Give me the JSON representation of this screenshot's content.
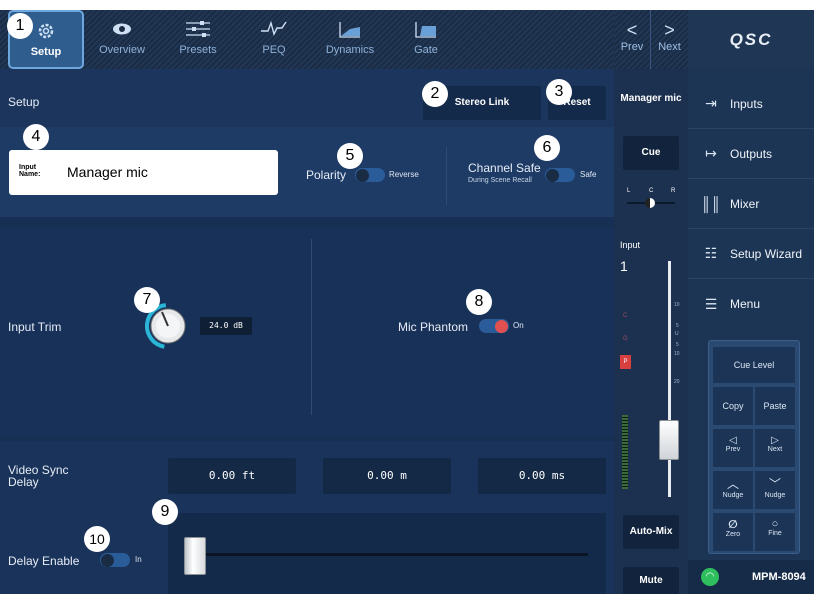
{
  "tabs": [
    {
      "label": "Setup",
      "icon": "gear-icon"
    },
    {
      "label": "Overview",
      "icon": "eye-icon"
    },
    {
      "label": "Presets",
      "icon": "sliders-icon"
    },
    {
      "label": "PEQ",
      "icon": "peq-curve-icon"
    },
    {
      "label": "Dynamics",
      "icon": "dynamics-icon"
    },
    {
      "label": "Gate",
      "icon": "gate-icon"
    }
  ],
  "nav": {
    "prev": "Prev",
    "next": "Next"
  },
  "brand": "QSC",
  "setup": {
    "title": "Setup",
    "stereo_link": "Stereo Link",
    "reset": "Reset",
    "input_name_label": "Input Name:",
    "input_name_value": "Manager mic",
    "polarity_label": "Polarity",
    "polarity_state": "Reverse",
    "channel_safe_label": "Channel Safe",
    "channel_safe_sub": "During Scene Recall",
    "channel_safe_state": "Safe",
    "input_trim_label": "Input Trim",
    "input_trim_value": "24.0 dB",
    "mic_phantom_label": "Mic Phantom",
    "mic_phantom_state": "On",
    "video_sync_label": "Video Sync Delay",
    "delay_ft": "0.00 ft",
    "delay_m": "0.00 m",
    "delay_ms": "0.00 ms",
    "delay_enable_label": "Delay Enable",
    "delay_enable_state": "In"
  },
  "strip": {
    "channel_name": "Manager mic",
    "cue": "Cue",
    "pan_l": "L",
    "pan_c": "C",
    "pan_r": "R",
    "input_label": "Input",
    "input_number": "1",
    "meter_c": "C",
    "meter_g": "G",
    "meter_p": "P",
    "scale": [
      "10",
      "5",
      "U",
      "5",
      "10",
      "",
      "20"
    ],
    "auto_mix": "Auto-Mix",
    "mute": "Mute"
  },
  "sidebar": {
    "items": [
      {
        "label": "Inputs",
        "icon": "inputs-icon"
      },
      {
        "label": "Outputs",
        "icon": "outputs-icon"
      },
      {
        "label": "Mixer",
        "icon": "mixer-icon"
      },
      {
        "label": "Setup Wizard",
        "icon": "wizard-icon"
      },
      {
        "label": "Menu",
        "icon": "menu-icon"
      }
    ],
    "cue_level": "Cue Level",
    "copy": "Copy",
    "paste": "Paste",
    "prev": "Prev",
    "next": "Next",
    "nudge_up": "Nudge",
    "nudge_down": "Nudge",
    "zero": "Zero",
    "fine": "Fine"
  },
  "device": {
    "name": "MPM-8094"
  },
  "callouts": [
    "1",
    "2",
    "3",
    "4",
    "5",
    "6",
    "7",
    "8",
    "9",
    "10"
  ],
  "colors": {
    "accent": "#2f5d8e",
    "toggle_on": "#e05050",
    "active_border": "#6ea6de",
    "meter_green": "#4caf50"
  }
}
